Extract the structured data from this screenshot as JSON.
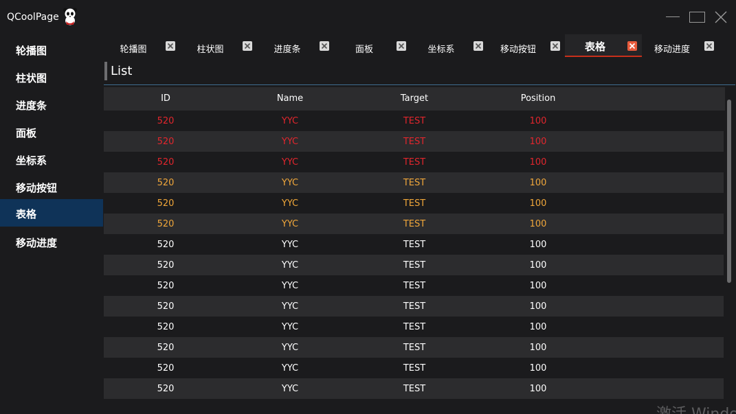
{
  "window": {
    "title": "QCoolPage",
    "logo": "panda-logo-icon"
  },
  "sidebar": {
    "items": [
      {
        "label": "轮播图"
      },
      {
        "label": "柱状图"
      },
      {
        "label": "进度条"
      },
      {
        "label": "面板"
      },
      {
        "label": "坐标系"
      },
      {
        "label": "移动按钮"
      },
      {
        "label": "表格",
        "active": true
      },
      {
        "label": "移动进度"
      }
    ]
  },
  "tabs": [
    {
      "label": "轮播图"
    },
    {
      "label": "柱状图"
    },
    {
      "label": "进度条"
    },
    {
      "label": "面板"
    },
    {
      "label": "坐标系"
    },
    {
      "label": "移动按钮"
    },
    {
      "label": "表格",
      "active": true
    },
    {
      "label": "移动进度"
    }
  ],
  "main": {
    "section_title": "List",
    "table": {
      "columns": [
        "ID",
        "Name",
        "Target",
        "Position"
      ],
      "rows": [
        {
          "cells": [
            "520",
            "YYC",
            "TEST",
            "100"
          ],
          "color": "#e2262d"
        },
        {
          "cells": [
            "520",
            "YYC",
            "TEST",
            "100"
          ],
          "color": "#e2262d"
        },
        {
          "cells": [
            "520",
            "YYC",
            "TEST",
            "100"
          ],
          "color": "#e2262d"
        },
        {
          "cells": [
            "520",
            "YYC",
            "TEST",
            "100"
          ],
          "color": "#f1a73a"
        },
        {
          "cells": [
            "520",
            "YYC",
            "TEST",
            "100"
          ],
          "color": "#f1a73a"
        },
        {
          "cells": [
            "520",
            "YYC",
            "TEST",
            "100"
          ],
          "color": "#f1a73a"
        },
        {
          "cells": [
            "520",
            "YYC",
            "TEST",
            "100"
          ],
          "color": "#ffffff"
        },
        {
          "cells": [
            "520",
            "YYC",
            "TEST",
            "100"
          ],
          "color": "#ffffff"
        },
        {
          "cells": [
            "520",
            "YYC",
            "TEST",
            "100"
          ],
          "color": "#ffffff"
        },
        {
          "cells": [
            "520",
            "YYC",
            "TEST",
            "100"
          ],
          "color": "#ffffff"
        },
        {
          "cells": [
            "520",
            "YYC",
            "TEST",
            "100"
          ],
          "color": "#ffffff"
        },
        {
          "cells": [
            "520",
            "YYC",
            "TEST",
            "100"
          ],
          "color": "#ffffff"
        },
        {
          "cells": [
            "520",
            "YYC",
            "TEST",
            "100"
          ],
          "color": "#ffffff"
        },
        {
          "cells": [
            "520",
            "YYC",
            "TEST",
            "100"
          ],
          "color": "#ffffff"
        }
      ]
    }
  },
  "watermark": "激活 Windows",
  "colors": {
    "background": "#1b1b1d",
    "active_sidebar": "#0f3358",
    "active_tab_close": "#e75b3c",
    "row_alt": "#2c2c2e",
    "header_line": "#3f6d91"
  }
}
